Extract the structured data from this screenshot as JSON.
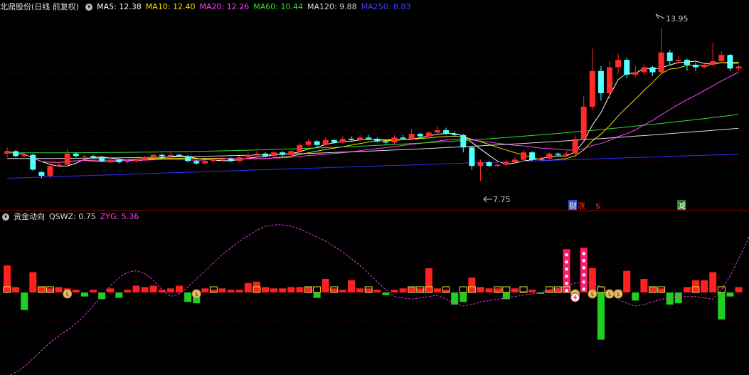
{
  "main_header": {
    "title": "北鼎股份(日线 前复权)",
    "ma": [
      {
        "label": "MA5: 12.38",
        "color": "#ffffff"
      },
      {
        "label": "MA10: 12.40",
        "color": "#f0e000"
      },
      {
        "label": "MA20: 12.26",
        "color": "#ff40ff"
      },
      {
        "label": "MA60: 10.44",
        "color": "#30e030"
      },
      {
        "label": "MA120: 9.88",
        "color": "#d8d8d8"
      },
      {
        "label": "MA250: 8.83",
        "color": "#2a2aff"
      }
    ]
  },
  "sub_header": {
    "title": "资金动向",
    "items": [
      {
        "label": "QSWZ: 0.75",
        "color": "#dddddd"
      },
      {
        "label": "ZYG: 5.36",
        "color": "#ff40ff"
      }
    ]
  },
  "annotations": {
    "high_label": "13.95",
    "low_label": "7.75",
    "events": [
      {
        "text": "财",
        "color": "#ffffff",
        "bg": "#3050c0"
      },
      {
        "text": "涨",
        "color": "#ff3030",
        "bg": "#000000"
      },
      {
        "text": "$",
        "color": "#ff3030",
        "bg": "#000000"
      },
      {
        "text": "减",
        "color": "#ffffff",
        "bg": "#208020"
      }
    ]
  },
  "colors": {
    "up": "#ff2a2a",
    "down": "#54ffff",
    "grid": "#7a0000",
    "axis": "#8a0000"
  },
  "chart_data": [
    {
      "type": "candlestick",
      "title": "北鼎股份(日线 前复权)",
      "price_range": [
        7.0,
        14.5
      ],
      "high": 13.95,
      "low": 7.75,
      "candles": [
        [
          8.85,
          8.95,
          9.1,
          8.7
        ],
        [
          8.95,
          8.75,
          9.0,
          8.7
        ],
        [
          8.75,
          8.8,
          8.85,
          8.7
        ],
        [
          8.8,
          8.2,
          8.85,
          8.15
        ],
        [
          8.1,
          7.95,
          8.15,
          7.85
        ],
        [
          7.95,
          8.35,
          8.4,
          7.85
        ],
        [
          8.35,
          8.4,
          8.5,
          8.3
        ],
        [
          8.4,
          8.85,
          9.05,
          8.4
        ],
        [
          8.85,
          8.75,
          8.9,
          8.7
        ],
        [
          8.75,
          8.75,
          8.8,
          8.7
        ],
        [
          8.75,
          8.7,
          8.8,
          8.65
        ],
        [
          8.7,
          8.55,
          8.75,
          8.5
        ],
        [
          8.55,
          8.6,
          8.65,
          8.5
        ],
        [
          8.6,
          8.5,
          8.65,
          8.45
        ],
        [
          8.5,
          8.55,
          8.6,
          8.45
        ],
        [
          8.55,
          8.6,
          8.65,
          8.5
        ],
        [
          8.6,
          8.7,
          8.75,
          8.55
        ],
        [
          8.7,
          8.8,
          8.85,
          8.65
        ],
        [
          8.8,
          8.75,
          8.85,
          8.7
        ],
        [
          8.75,
          8.8,
          8.9,
          8.7
        ],
        [
          8.8,
          8.75,
          8.85,
          8.7
        ],
        [
          8.75,
          8.55,
          8.8,
          8.5
        ],
        [
          8.55,
          8.45,
          8.6,
          8.4
        ],
        [
          8.45,
          8.55,
          8.6,
          8.4
        ],
        [
          8.55,
          8.6,
          8.65,
          8.5
        ],
        [
          8.6,
          8.65,
          8.7,
          8.55
        ],
        [
          8.65,
          8.55,
          8.7,
          8.5
        ],
        [
          8.55,
          8.7,
          8.75,
          8.5
        ],
        [
          8.7,
          8.8,
          8.9,
          8.65
        ],
        [
          8.8,
          8.85,
          8.95,
          8.75
        ],
        [
          8.85,
          8.75,
          8.9,
          8.7
        ],
        [
          8.75,
          8.9,
          8.95,
          8.7
        ],
        [
          8.9,
          8.8,
          8.95,
          8.75
        ],
        [
          8.8,
          8.95,
          9.0,
          8.75
        ],
        [
          8.95,
          9.2,
          9.3,
          8.9
        ],
        [
          9.2,
          9.35,
          9.45,
          9.15
        ],
        [
          9.35,
          9.2,
          9.4,
          9.1
        ],
        [
          9.2,
          9.4,
          9.5,
          9.15
        ],
        [
          9.4,
          9.3,
          9.45,
          9.25
        ],
        [
          9.3,
          9.45,
          9.55,
          9.25
        ],
        [
          9.45,
          9.4,
          9.55,
          9.35
        ],
        [
          9.4,
          9.5,
          9.6,
          9.35
        ],
        [
          9.5,
          9.45,
          9.6,
          9.4
        ],
        [
          9.45,
          9.35,
          9.5,
          9.3
        ],
        [
          9.35,
          9.3,
          9.4,
          9.2
        ],
        [
          9.3,
          9.5,
          9.6,
          9.25
        ],
        [
          9.5,
          9.45,
          9.6,
          9.4
        ],
        [
          9.45,
          9.65,
          9.85,
          9.4
        ],
        [
          9.65,
          9.55,
          9.7,
          9.5
        ],
        [
          9.55,
          9.7,
          9.75,
          9.5
        ],
        [
          9.7,
          9.8,
          9.95,
          9.6
        ],
        [
          9.8,
          9.65,
          9.9,
          9.6
        ],
        [
          9.65,
          9.6,
          9.75,
          9.55
        ],
        [
          9.6,
          9.1,
          9.65,
          8.9
        ],
        [
          9.1,
          8.35,
          9.15,
          8.2
        ],
        [
          8.35,
          8.5,
          8.6,
          7.75
        ],
        [
          8.5,
          8.35,
          8.55,
          8.3
        ],
        [
          8.35,
          8.4,
          8.45,
          8.3
        ],
        [
          8.4,
          8.5,
          8.6,
          8.35
        ],
        [
          8.5,
          8.6,
          8.7,
          8.45
        ],
        [
          8.6,
          8.9,
          9.0,
          8.55
        ],
        [
          8.9,
          8.6,
          8.95,
          8.55
        ],
        [
          8.6,
          8.65,
          8.75,
          8.55
        ],
        [
          8.65,
          8.85,
          8.9,
          8.6
        ],
        [
          8.85,
          8.8,
          8.9,
          8.75
        ],
        [
          8.8,
          8.85,
          8.95,
          8.75
        ],
        [
          8.85,
          9.45,
          9.6,
          8.8
        ],
        [
          9.45,
          10.75,
          11.2,
          9.45
        ],
        [
          10.75,
          12.2,
          13.1,
          10.6
        ],
        [
          12.2,
          11.3,
          12.4,
          11.0
        ],
        [
          11.3,
          12.35,
          12.6,
          11.1
        ],
        [
          12.35,
          12.65,
          12.9,
          12.1
        ],
        [
          12.65,
          12.05,
          12.75,
          11.9
        ],
        [
          12.05,
          12.15,
          12.4,
          11.95
        ],
        [
          12.15,
          12.35,
          12.5,
          12.05
        ],
        [
          12.35,
          12.15,
          12.4,
          12.0
        ],
        [
          12.15,
          12.95,
          13.95,
          12.1
        ],
        [
          12.95,
          12.6,
          13.05,
          12.45
        ],
        [
          12.6,
          12.65,
          12.8,
          12.5
        ],
        [
          12.65,
          12.45,
          12.7,
          12.2
        ],
        [
          12.45,
          12.35,
          12.55,
          12.2
        ],
        [
          12.35,
          12.45,
          12.55,
          12.3
        ],
        [
          12.45,
          12.6,
          13.35,
          12.4
        ],
        [
          12.6,
          12.85,
          13.0,
          12.55
        ],
        [
          12.85,
          12.3,
          12.9,
          12.2
        ],
        [
          12.3,
          12.38,
          12.45,
          12.2
        ]
      ],
      "moving_averages": [
        {
          "name": "MA5",
          "value": 12.38
        },
        {
          "name": "MA10",
          "value": 12.4
        },
        {
          "name": "MA20",
          "value": 12.26
        },
        {
          "name": "MA60",
          "value": 10.44
        },
        {
          "name": "MA120",
          "value": 9.88
        },
        {
          "name": "MA250",
          "value": 8.83
        }
      ]
    },
    {
      "type": "bar",
      "title": "资金动向",
      "series": [
        {
          "name": "QSWZ",
          "last": 0.75,
          "values": [
            2.0,
            0.4,
            -1.3,
            1.5,
            0.4,
            0.3,
            0.4,
            0.3,
            0.2,
            -0.3,
            0.2,
            -0.5,
            0.3,
            -0.4,
            0.2,
            0.5,
            0.4,
            0.5,
            0.2,
            0.3,
            0.5,
            -0.7,
            -0.8,
            0.3,
            0.2,
            0.3,
            0.2,
            0.2,
            0.7,
            0.8,
            0.4,
            0.3,
            0.3,
            0.4,
            0.4,
            0.4,
            -0.4,
            1.0,
            0.3,
            0.2,
            0.9,
            0.3,
            0.3,
            0.2,
            -0.2,
            0.2,
            0.3,
            0.4,
            0.3,
            1.8,
            0.3,
            0.2,
            -0.9,
            -0.7,
            1.1,
            0.4,
            0.3,
            0.3,
            -0.5,
            0.3,
            0.1,
            0.2,
            -0.1,
            0.2,
            0.3,
            3.2,
            -0.4,
            3.3,
            1.8,
            -3.5,
            -0.4,
            0.2,
            1.6,
            -0.6,
            1.0,
            0.4,
            0.3,
            -0.9,
            -0.8,
            0.4,
            0.9,
            0.9,
            1.5,
            -2.0,
            -0.3,
            0.4
          ]
        },
        {
          "name": "ZYG",
          "last": 5.36,
          "values": [
            -6.2,
            -5.9,
            -5.5,
            -4.9,
            -4.3,
            -3.7,
            -3.2,
            -2.8,
            -2.3,
            -1.7,
            -1.0,
            -0.2,
            0.5,
            1.1,
            1.5,
            1.6,
            1.4,
            0.9,
            0.2,
            -0.3,
            -0.1,
            0.4,
            1.0,
            1.6,
            2.2,
            2.8,
            3.3,
            3.8,
            4.2,
            4.6,
            4.9,
            5.0,
            5.0,
            4.9,
            4.7,
            4.4,
            4.1,
            3.8,
            3.4,
            3.0,
            2.5,
            2.0,
            1.4,
            0.8,
            0.2,
            -0.3,
            -0.4,
            -0.5,
            -0.4,
            -0.3,
            -0.2,
            -0.5,
            -0.8,
            -1.0,
            -0.9,
            -0.7,
            -0.6,
            -0.5,
            -0.4,
            -0.3,
            -0.2,
            -0.1,
            0.0,
            0.2,
            0.3,
            0.5,
            0.7,
            0.8,
            0.7,
            0.4,
            0.0,
            -0.5,
            -0.8,
            -1.0,
            -0.9,
            -0.7,
            -0.5,
            -0.4,
            -0.3,
            -0.3,
            -0.3,
            -0.4,
            -0.5,
            0.2,
            1.2,
            2.5,
            3.8,
            5.36
          ]
        }
      ],
      "signal_markers": [
        {
          "index": 0,
          "shape": "square"
        },
        {
          "index": 4,
          "shape": "square"
        },
        {
          "index": 5,
          "shape": "square"
        },
        {
          "index": 7,
          "shape": "moneybag"
        },
        {
          "index": 22,
          "shape": "moneybag"
        },
        {
          "index": 24,
          "shape": "square"
        },
        {
          "index": 29,
          "shape": "square"
        },
        {
          "index": 35,
          "shape": "square"
        },
        {
          "index": 36,
          "shape": "square"
        },
        {
          "index": 38,
          "shape": "square"
        },
        {
          "index": 42,
          "shape": "square"
        },
        {
          "index": 47,
          "shape": "square"
        },
        {
          "index": 48,
          "shape": "square"
        },
        {
          "index": 49,
          "shape": "square"
        },
        {
          "index": 51,
          "shape": "square"
        },
        {
          "index": 53,
          "shape": "square"
        },
        {
          "index": 54,
          "shape": "square"
        },
        {
          "index": 57,
          "shape": "square"
        },
        {
          "index": 58,
          "shape": "square"
        },
        {
          "index": 60,
          "shape": "square"
        },
        {
          "index": 63,
          "shape": "square"
        },
        {
          "index": 64,
          "shape": "square"
        },
        {
          "index": 65,
          "shape": "square"
        },
        {
          "index": 66,
          "shape": "moneybag"
        },
        {
          "index": 68,
          "shape": "moneybag"
        },
        {
          "index": 69,
          "shape": "square"
        },
        {
          "index": 70,
          "shape": "moneybag"
        },
        {
          "index": 71,
          "shape": "moneybag"
        },
        {
          "index": 75,
          "shape": "square"
        },
        {
          "index": 76,
          "shape": "square"
        },
        {
          "index": 80,
          "shape": "square"
        },
        {
          "index": 83,
          "shape": "square"
        }
      ]
    }
  ]
}
